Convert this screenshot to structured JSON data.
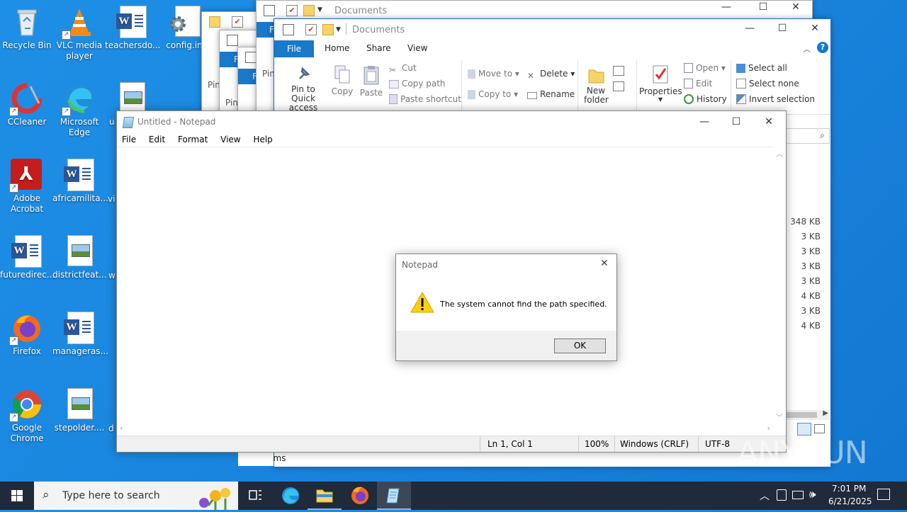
{
  "desktop_icons": [
    {
      "name": "Recycle Bin",
      "type": "recycle"
    },
    {
      "name": "VLC media player",
      "type": "vlc"
    },
    {
      "name": "teachersdo...",
      "type": "word"
    },
    {
      "name": "config.in",
      "type": "config"
    },
    {
      "name": "CCleaner",
      "type": "ccleaner"
    },
    {
      "name": "Microsoft Edge",
      "type": "edge"
    },
    {
      "name": "u",
      "type": "image"
    },
    {
      "name": "Adobe Acrobat",
      "type": "acrobat"
    },
    {
      "name": "africamilita...",
      "type": "word"
    },
    {
      "name": "vi",
      "type": "partial"
    },
    {
      "name": "futuredirec...",
      "type": "word"
    },
    {
      "name": "districtfeat...",
      "type": "image"
    },
    {
      "name": "w",
      "type": "partial"
    },
    {
      "name": "Firefox",
      "type": "firefox"
    },
    {
      "name": "manageras...",
      "type": "word"
    },
    {
      "name": "Google Chrome",
      "type": "chrome"
    },
    {
      "name": "stepolder....",
      "type": "image"
    },
    {
      "name": "d",
      "type": "partial"
    }
  ],
  "explorer": {
    "title": "Documents",
    "ribbon_tabs": [
      "File",
      "Home",
      "Share",
      "View"
    ],
    "clipboard": {
      "pin": "Pin to Quick access",
      "copy": "Copy",
      "paste": "Paste",
      "cut": "Cut",
      "copy_path": "Copy path",
      "paste_shortcut": "Paste shortcut"
    },
    "organize": {
      "move_to": "Move to",
      "copy_to": "Copy to",
      "delete": "Delete",
      "rename": "Rename"
    },
    "new": {
      "new_folder": "New folder"
    },
    "open": {
      "properties": "Properties",
      "open": "Open",
      "edit": "Edit",
      "history": "History"
    },
    "select": {
      "select_all": "Select all",
      "select_none": "Select none",
      "invert": "Invert selection"
    },
    "file_sizes": [
      "348 KB",
      "3 KB",
      "3 KB",
      "3 KB",
      "3 KB",
      "4 KB",
      "3 KB",
      "4 KB"
    ],
    "status": "11 items",
    "behind_file_tab": "F",
    "behind_pin": "Pin"
  },
  "notepad": {
    "title": "Untitled - Notepad",
    "menu": [
      "File",
      "Edit",
      "Format",
      "View",
      "Help"
    ],
    "status": {
      "position": "Ln 1, Col 1",
      "zoom": "100%",
      "line_endings": "Windows (CRLF)",
      "encoding": "UTF-8"
    }
  },
  "dialog": {
    "title": "Notepad",
    "message": "The system cannot find the path specified.",
    "ok": "OK"
  },
  "taskbar": {
    "search_placeholder": "Type here to search",
    "time": "7:01 PM",
    "date": "6/21/2025"
  },
  "watermark": "ANY.RUN",
  "colors": {
    "desktop": "#1a86df",
    "accent": "#1979ca",
    "taskbar": "#1f2a3a"
  }
}
